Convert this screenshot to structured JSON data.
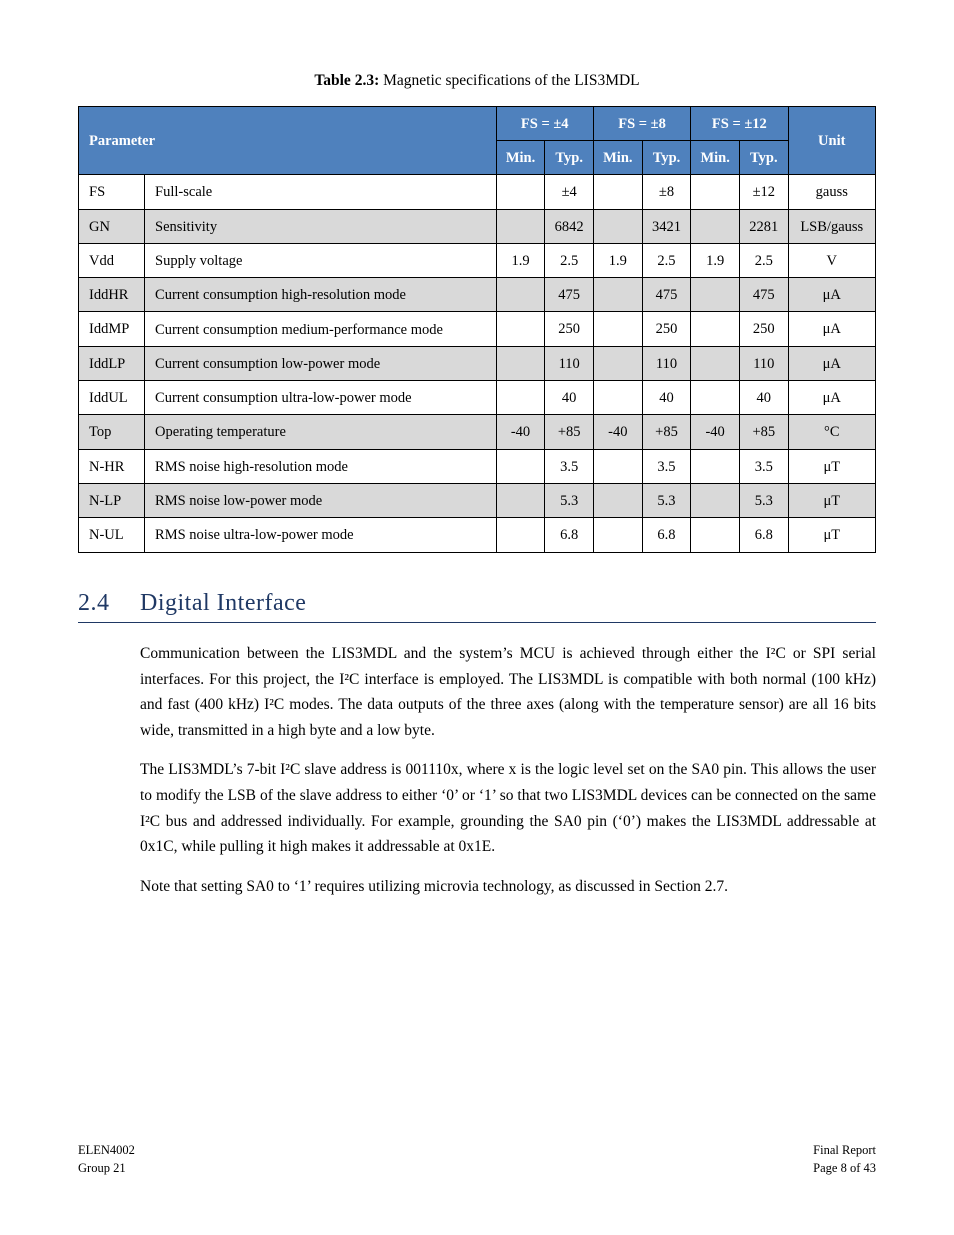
{
  "caption": {
    "label": "Table 2.3:",
    "text": " Magnetic specifications of the LIS3MDL"
  },
  "table": {
    "headers": {
      "parameter": "Parameter",
      "fs4": "FS = ±4",
      "fs8": "FS = ±8",
      "fs12": "FS = ±12",
      "unit": "Unit",
      "min": "Min.",
      "typ": "Typ."
    },
    "rows": [
      {
        "stripe": false,
        "symbol": "FS",
        "param": "Full-scale",
        "c": [
          "",
          "±4",
          "",
          "±8",
          "",
          "±12"
        ],
        "unit": "gauss"
      },
      {
        "stripe": true,
        "symbol": "GN",
        "param": "Sensitivity",
        "c": [
          "",
          "6842",
          "",
          "3421",
          "",
          "2281"
        ],
        "unit": "LSB/gauss"
      },
      {
        "stripe": false,
        "symbol": "Vdd",
        "param": "Supply voltage",
        "c": [
          "1.9",
          "2.5",
          "1.9",
          "2.5",
          "1.9",
          "2.5"
        ],
        "unit": "V"
      },
      {
        "stripe": true,
        "symbol": "IddHR",
        "param": "Current consumption high-resolution mode",
        "c": [
          "",
          "475",
          "",
          "475",
          "",
          "475"
        ],
        "unit": "μA",
        "wrap": true
      },
      {
        "stripe": false,
        "symbol": "IddMP",
        "param": "Current consumption medium-performance mode",
        "c": [
          "",
          "250",
          "",
          "250",
          "",
          "250"
        ],
        "unit": "μA",
        "wrap": true
      },
      {
        "stripe": true,
        "symbol": "IddLP",
        "param": "Current consumption low-power mode",
        "c": [
          "",
          "110",
          "",
          "110",
          "",
          "110"
        ],
        "unit": "μA",
        "wrap": true
      },
      {
        "stripe": false,
        "symbol": "IddUL",
        "param": "Current consumption ultra-low-power mode",
        "c": [
          "",
          "40",
          "",
          "40",
          "",
          "40"
        ],
        "unit": "μA",
        "wrap": true
      },
      {
        "stripe": true,
        "symbol": "Top",
        "param": "Operating temperature",
        "c": [
          "-40",
          "+85",
          "-40",
          "+85",
          "-40",
          "+85"
        ],
        "unit": "°C"
      },
      {
        "stripe": false,
        "symbol": "N-HR",
        "param": "RMS noise high-resolution mode",
        "c": [
          "",
          "3.5",
          "",
          "3.5",
          "",
          "3.5"
        ],
        "unit": "μT",
        "wrap": true
      },
      {
        "stripe": true,
        "symbol": "N-LP",
        "param": "RMS noise low-power mode",
        "c": [
          "",
          "5.3",
          "",
          "5.3",
          "",
          "5.3"
        ],
        "unit": "μT"
      },
      {
        "stripe": false,
        "symbol": "N-UL",
        "param": "RMS noise ultra-low-power mode",
        "c": [
          "",
          "6.8",
          "",
          "6.8",
          "",
          "6.8"
        ],
        "unit": "μT",
        "wrap": true
      }
    ]
  },
  "section": {
    "num": "2.4",
    "title": "Digital Interface"
  },
  "p1": "Communication between the LIS3MDL and the system’s MCU is achieved through either the I²C or SPI serial interfaces. For this project, the I²C interface is employed. The LIS3MDL is compatible with both normal (100 kHz) and fast (400 kHz) I²C modes. The data outputs of the three axes (along with the temperature sensor) are all 16 bits wide, transmitted in a high byte and a low byte.",
  "p2": "The LIS3MDL’s 7-bit I²C slave address is 001110x, where x is the logic level set on the SA0 pin. This allows the user to modify the LSB of the slave address to either ‘0’ or ‘1’ so that two LIS3MDL devices can be connected on the same I²C bus and addressed individually. For example, grounding the SA0 pin (‘0’) makes the LIS3MDL addressable at 0x1C, while pulling it high makes it addressable at 0x1E.",
  "p3": "Note that setting SA0 to ‘1’ requires utilizing microvia technology, as discussed in Section 2.7.",
  "footer": {
    "left1": "ELEN4002",
    "left2": "Group 21",
    "right1": "Final Report",
    "right2": "Page 8 of 43"
  }
}
